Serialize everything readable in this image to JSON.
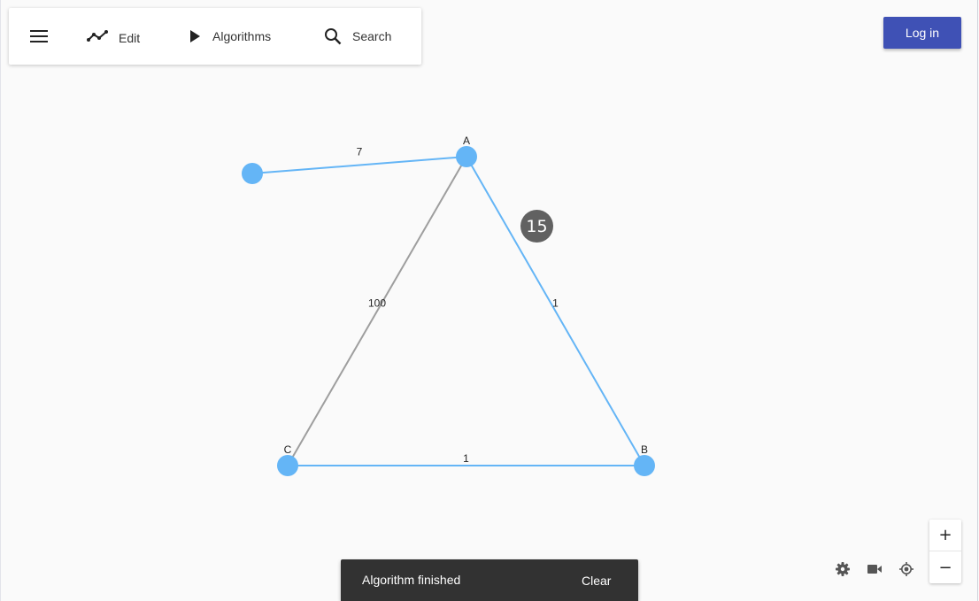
{
  "toolbar": {
    "edit_label": "Edit",
    "algorithms_label": "Algorithms",
    "search_label": "Search"
  },
  "header": {
    "login_label": "Log in"
  },
  "colors": {
    "primary": "#3f51b5",
    "node": "#64b5f6",
    "edge_active": "#64b5f6",
    "edge_inactive": "#9e9e9e",
    "badge": "#616161",
    "snackbar": "#323232"
  },
  "graph": {
    "nodes": [
      {
        "id": "A",
        "label": "A"
      },
      {
        "id": "B",
        "label": "B"
      },
      {
        "id": "C",
        "label": "C"
      },
      {
        "id": "D",
        "label": ""
      }
    ],
    "edges": [
      {
        "from": "D",
        "to": "A",
        "weight": "7",
        "active": true
      },
      {
        "from": "A",
        "to": "C",
        "weight": "100",
        "active": false
      },
      {
        "from": "A",
        "to": "B",
        "weight": "1",
        "active": true
      },
      {
        "from": "C",
        "to": "B",
        "weight": "1",
        "active": true
      }
    ]
  },
  "step_badge": "15",
  "zoom": {
    "in_label": "+",
    "out_label": "−"
  },
  "controls": {
    "settings_icon": "gear-icon",
    "camera_icon": "videocam-icon",
    "locate_icon": "locate-icon"
  },
  "snackbar": {
    "message": "Algorithm finished",
    "action_label": "Clear"
  }
}
